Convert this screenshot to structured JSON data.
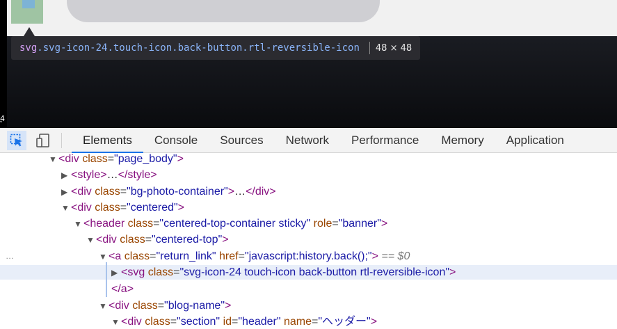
{
  "tooltip": {
    "tag": "svg",
    "classes": ".svg-icon-24.touch-icon.back-button.rtl-reversible-icon",
    "size": "48 × 48"
  },
  "side_chars": "4\nﾞ",
  "toolbar": {
    "tabs": [
      {
        "label": "Elements",
        "active": true
      },
      {
        "label": "Console"
      },
      {
        "label": "Sources"
      },
      {
        "label": "Network"
      },
      {
        "label": "Performance"
      },
      {
        "label": "Memory"
      },
      {
        "label": "Application"
      }
    ]
  },
  "dom": {
    "l0": {
      "tag_open": "<div",
      "attr": "class",
      "val": "\"page_body\"",
      "close": ">"
    },
    "l1": {
      "open": "<style>",
      "ellipsis": "…",
      "close": "</style>"
    },
    "l2": {
      "tag_open": "<div",
      "attr": "class",
      "val": "\"bg-photo-container\"",
      "mid": ">",
      "ellipsis": "…",
      "close": "</div>"
    },
    "l3": {
      "tag_open": "<div",
      "attr": "class",
      "val": "\"centered\"",
      "close": ">"
    },
    "l4": {
      "tag_open": "<header",
      "attr": "class",
      "val": "\"centered-top-container sticky\"",
      "attr2": "role",
      "val2": "\"banner\"",
      "close": ">"
    },
    "l5": {
      "tag_open": "<div",
      "attr": "class",
      "val": "\"centered-top\"",
      "close": ">"
    },
    "l6": {
      "tag_open": "<a",
      "attr": "class",
      "val": "\"return_link\"",
      "attr2": "href",
      "val2": "\"javascript:history.back();\"",
      "close": ">",
      "marker": "== $0"
    },
    "l7": {
      "tag_open": "<svg",
      "attr": "class",
      "val": "\"svg-icon-24 touch-icon back-button rtl-reversible-icon\"",
      "close": ">"
    },
    "l8": {
      "close": "</a>"
    },
    "l9": {
      "tag_open": "<div",
      "attr": "class",
      "val": "\"blog-name\"",
      "close": ">"
    },
    "l10": {
      "tag_open": "<div",
      "attr": "class",
      "val": "\"section\"",
      "attr2": "id",
      "val2": "\"header\"",
      "attr3": "name",
      "val3": "\"ヘッダー\"",
      "close": ">"
    },
    "dots": "…"
  }
}
